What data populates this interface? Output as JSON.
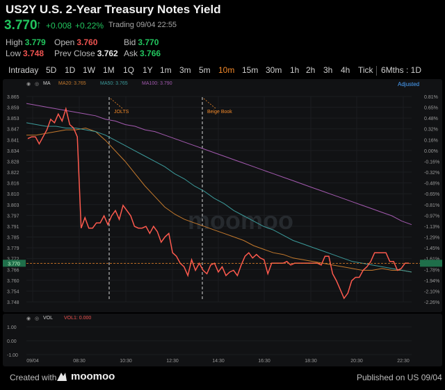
{
  "header": {
    "title": "US2Y U.S. 2-Year Treasury Notes Yield",
    "price": "3.770",
    "change": "+0.008",
    "change_pct": "+0.22%",
    "status": "Trading 09/04 22:55",
    "high_label": "High",
    "high": "3.779",
    "open_label": "Open",
    "open": "3.760",
    "bid_label": "Bid",
    "bid": "3.770",
    "low_label": "Low",
    "low": "3.748",
    "prev_close_label": "Prev Close",
    "prev_close": "3.762",
    "ask_label": "Ask",
    "ask": "3.766"
  },
  "tabs": [
    "Intraday",
    "5D",
    "1D",
    "1W",
    "1M",
    "1Q",
    "1Y",
    "1m",
    "3m",
    "5m",
    "10m",
    "15m",
    "30m",
    "1h",
    "2h",
    "3h",
    "4h",
    "Tick"
  ],
  "active_tab": "10m",
  "period_select": "6Mths : 1D",
  "legend": {
    "ma_label": "MA",
    "ma20": "MA20: 3.765",
    "ma50": "MA50: 3.765",
    "ma100": "MA100: 3.790",
    "adjusted": "Adjusted"
  },
  "vol_legend": {
    "vol_label": "VOL",
    "vol1": "VOL1: 0.000"
  },
  "watermark": "moomoo",
  "footer": {
    "created": "Created with",
    "brand": "moomoo",
    "published": "Published on US 09/04"
  },
  "colors": {
    "price_line": "#ff5a4e",
    "ma20": "#c57a2d",
    "ma50": "#3c9b9b",
    "ma100": "#a45ab0",
    "green": "#22c55e",
    "red": "#ef5350",
    "accent": "#f48a2a"
  },
  "chart_data": {
    "type": "line",
    "ylim": [
      3.748,
      3.865
    ],
    "y_ticks": [
      "3.865",
      "3.859",
      "3.853",
      "3.847",
      "3.841",
      "3.834",
      "3.828",
      "3.822",
      "3.816",
      "3.810",
      "3.803",
      "3.797",
      "3.791",
      "3.785",
      "3.779",
      "3.772",
      "3.766",
      "3.760",
      "3.754",
      "3.748"
    ],
    "pct_ticks": [
      "0.81%",
      "0.65%",
      "0.48%",
      "0.32%",
      "0.16%",
      "0.00%",
      "-0.16%",
      "-0.32%",
      "-0.48%",
      "-0.65%",
      "-0.81%",
      "-0.97%",
      "-1.13%",
      "-1.29%",
      "-1.45%",
      "-1.61%",
      "-1.78%",
      "-1.94%",
      "-2.10%",
      "-2.26%"
    ],
    "x_ticks": [
      "09/04",
      "08:30",
      "10:30",
      "12:30",
      "14:30",
      "16:30",
      "18:30",
      "20:30",
      "22:30"
    ],
    "current_price": 3.77,
    "vol_y_ticks": [
      "1.00",
      "0.00",
      "-1.00"
    ],
    "annotations": [
      "JOLTS",
      "Beige Book"
    ],
    "series": [
      {
        "name": "MA20",
        "values": [
          3.843,
          3.843,
          3.844,
          3.845,
          3.846,
          3.846,
          3.847,
          3.845,
          3.84,
          3.834,
          3.828,
          3.821,
          3.814,
          3.808,
          3.802,
          3.798,
          3.795,
          3.793,
          3.791,
          3.789,
          3.787,
          3.785,
          3.783,
          3.78,
          3.778,
          3.776,
          3.775,
          3.773,
          3.772,
          3.771,
          3.77,
          3.769,
          3.768,
          3.767,
          3.766,
          3.766,
          3.767,
          3.766,
          3.766,
          3.765
        ]
      },
      {
        "name": "MA50",
        "values": [
          3.85,
          3.849,
          3.848,
          3.848,
          3.847,
          3.847,
          3.846,
          3.845,
          3.843,
          3.84,
          3.837,
          3.834,
          3.831,
          3.828,
          3.825,
          3.821,
          3.818,
          3.814,
          3.811,
          3.807,
          3.804,
          3.8,
          3.797,
          3.794,
          3.791,
          3.789,
          3.786,
          3.783,
          3.781,
          3.779,
          3.777,
          3.775,
          3.773,
          3.771,
          3.77,
          3.769,
          3.768,
          3.767,
          3.766,
          3.765
        ]
      },
      {
        "name": "MA100",
        "values": [
          3.861,
          3.86,
          3.859,
          3.858,
          3.857,
          3.856,
          3.855,
          3.854,
          3.852,
          3.851,
          3.849,
          3.848,
          3.846,
          3.845,
          3.843,
          3.841,
          3.839,
          3.837,
          3.835,
          3.833,
          3.831,
          3.829,
          3.827,
          3.825,
          3.823,
          3.821,
          3.819,
          3.817,
          3.815,
          3.813,
          3.811,
          3.809,
          3.807,
          3.805,
          3.803,
          3.801,
          3.799,
          3.797,
          3.794,
          3.792
        ]
      }
    ],
    "price_values": [
      3.841,
      3.842,
      3.842,
      3.838,
      3.842,
      3.846,
      3.852,
      3.85,
      3.855,
      3.851,
      3.858,
      3.849,
      3.847,
      3.842,
      3.79,
      3.796,
      3.79,
      3.79,
      3.793,
      3.793,
      3.797,
      3.792,
      3.797,
      3.8,
      3.795,
      3.803,
      3.8,
      3.797,
      3.791,
      3.79,
      3.79,
      3.791,
      3.787,
      3.791,
      3.788,
      3.782,
      3.785,
      3.787,
      3.776,
      3.774,
      3.77,
      3.768,
      3.763,
      3.772,
      3.766,
      3.77,
      3.766,
      3.764,
      3.769,
      3.77,
      3.765,
      3.768,
      3.763,
      3.765,
      3.766,
      3.763,
      3.769,
      3.774,
      3.776,
      3.773,
      3.775,
      3.773,
      3.772,
      3.764,
      3.77,
      3.77,
      3.77,
      3.77,
      3.771,
      3.769,
      3.77,
      3.77,
      3.77,
      3.77,
      3.77,
      3.77,
      3.77,
      3.769,
      3.774,
      3.774,
      3.764,
      3.76,
      3.755,
      3.75,
      3.753,
      3.76,
      3.762,
      3.762,
      3.766,
      3.768,
      3.771,
      3.776,
      3.776,
      3.776,
      3.776,
      3.771,
      3.771,
      3.766,
      3.767,
      3.77,
      3.77
    ]
  }
}
